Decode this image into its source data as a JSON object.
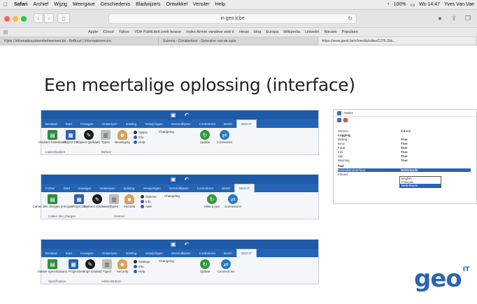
{
  "menubar": {
    "apple": "",
    "items": [
      "Safari",
      "Archief",
      "Wijzig",
      "Weergave",
      "Geschiedenis",
      "Bladwijzers",
      "Ontwikkel",
      "Venster",
      "Help"
    ],
    "battery": "100%",
    "clock": "Wo 14:47",
    "user": "Yves Van Vae"
  },
  "toolbar": {
    "url": "in geo.it.be",
    "traffic_colors": [
      "#ff5f57",
      "#febc2e",
      "#28c840"
    ]
  },
  "favorites": [
    "Apple",
    "iCloud",
    "Yahoo",
    "VDA Publiciteit-zoek bowse",
    "Index-Arrete vandeve web it",
    "nieuw",
    "blog",
    "Europa",
    "Wikipedia",
    "Linkedin",
    "Nieuws",
    "Populaire"
  ],
  "tabs": [
    {
      "label": "Hjele | Informatiesysteembeheersnet.be - BeBuurt | Informatierem.inc",
      "active": false
    },
    {
      "label": "Externs - Crisisbeheer - Gebruiker van de suite",
      "active": false
    },
    {
      "label": "https://www.geoit.be/nl/media/video/1276-2bb...",
      "active": true
    }
  ],
  "slide": {
    "title": "Een meertalige oplossing (interface)"
  },
  "ribbons": [
    {
      "tabs": [
        "Bestand",
        "Start",
        "Invoegen",
        "Ontwerpen",
        "Indeling",
        "Verwijzingen",
        "Verzendlijsten",
        "Controleren",
        "Beeld",
        "GEO-IT"
      ],
      "selected_tab": 9,
      "big_icons": [
        "Modules lastenboek",
        "Project DB",
        "Opties (globaal)",
        "Types",
        "Beveiliging"
      ],
      "small_options": [
        "Opties",
        "Info",
        "Help"
      ],
      "changelog": "Changelog",
      "round_icons": [
        "Update",
        "Connecties"
      ],
      "groups": [
        "Lastenboeken",
        "Beheer"
      ]
    },
    {
      "tabs": [
        "Fichier",
        "Start",
        "Invoegen",
        "Ontwerpen",
        "Indeling",
        "Verwijzingen",
        "Verzendlijsten",
        "Controleren",
        "Beeld",
        "GEO-IT"
      ],
      "selected_tab": 9,
      "big_icons": [
        "Cahier des charges principal",
        "Projet DB",
        "Options (Globales)",
        "Types",
        "Sécurité"
      ],
      "small_options": [
        "Options",
        "Info",
        "Aide"
      ],
      "changelog": "Changelog",
      "round_icons": [
        "Mise à jour",
        "Connexions"
      ],
      "groups": [
        "Cahier des charges",
        "Gestion"
      ]
    },
    {
      "tabs": [
        "Bestand",
        "Start",
        "Invoegen",
        "Ontwerpen",
        "Indeling",
        "Verwijzingen",
        "Verzendlijsten",
        "Controleren",
        "Beeld",
        "GEO-IT"
      ],
      "selected_tab": 9,
      "big_icons": [
        "Master specifications",
        "Project",
        "Settings (Global)",
        "Types",
        "Security"
      ],
      "small_options": [
        "Settings",
        "Info",
        "Help"
      ],
      "changelog": "Changelog",
      "round_icons": [
        "Update",
        "Connections"
      ],
      "groups": [
        "Specification",
        "Administration"
      ]
    }
  ],
  "props": {
    "header": "Opties",
    "rows": [
      {
        "k": "Version",
        "v": "2.0.1.0",
        "type": "normal"
      },
      {
        "k": "Logging",
        "v": "",
        "type": "cat"
      },
      {
        "k": "Debug",
        "v": "True",
        "type": "normal"
      },
      {
        "k": "Error",
        "v": "True",
        "type": "normal"
      },
      {
        "k": "Fatal",
        "v": "True",
        "type": "normal"
      },
      {
        "k": "Info",
        "v": "True",
        "type": "normal"
      },
      {
        "k": "Sql",
        "v": "True",
        "type": "normal"
      },
      {
        "k": "Warning",
        "v": "True",
        "type": "normal"
      },
      {
        "k": "Taal",
        "v": "",
        "type": "cat"
      },
      {
        "k": "Gebruikersinterface",
        "v": "Nederlands",
        "type": "hl"
      },
      {
        "k": "Inhoud",
        "v": "Nederlands",
        "type": "normal"
      }
    ],
    "dropdown": [
      "English",
      "Français",
      "Nederlands"
    ],
    "dropdown_selected": 2
  },
  "logo": {
    "text": "geo",
    "sup": "IT"
  }
}
